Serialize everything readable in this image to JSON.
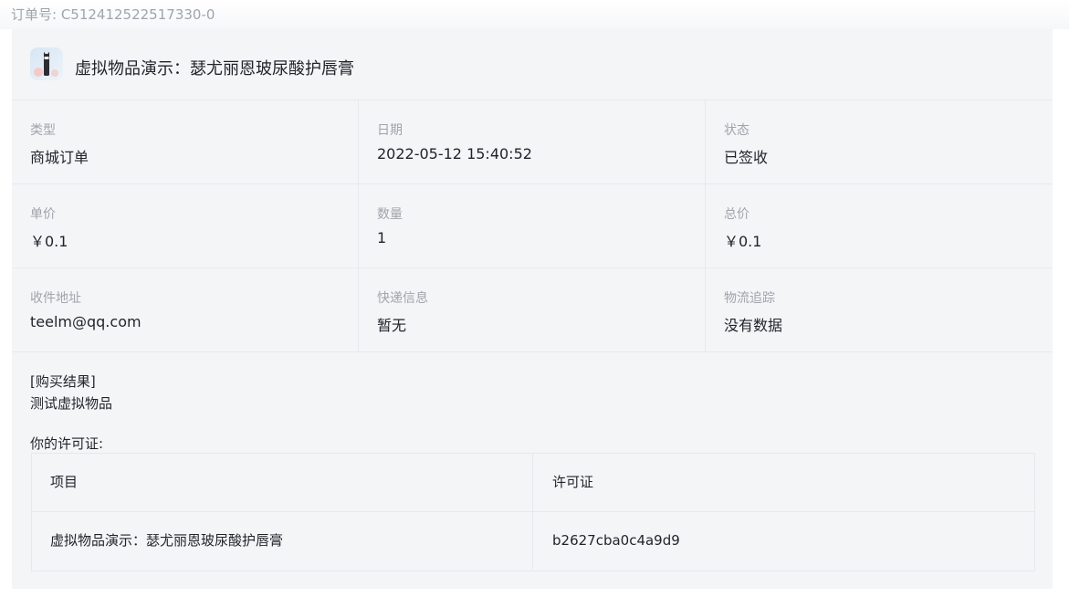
{
  "order": {
    "number_label": "订单号: C512412522517330-0"
  },
  "product": {
    "title": "虚拟物品演示：瑟尤丽恩玻尿酸护唇膏",
    "thumb_icon": "lip-balm-product-image"
  },
  "details": [
    [
      {
        "label": "类型",
        "value": "商城订单"
      },
      {
        "label": "日期",
        "value": "2022-05-12 15:40:52"
      },
      {
        "label": "状态",
        "value": "已签收"
      }
    ],
    [
      {
        "label": "单价",
        "value": "￥0.1"
      },
      {
        "label": "数量",
        "value": "1"
      },
      {
        "label": "总价",
        "value": "￥0.1"
      }
    ],
    [
      {
        "label": "收件地址",
        "value": "teelm@qq.com"
      },
      {
        "label": "快递信息",
        "value": "暂无"
      },
      {
        "label": "物流追踪",
        "value": "没有数据"
      }
    ]
  ],
  "result": {
    "heading": "[购买结果]",
    "text": "测试虚拟物品",
    "license_title": "你的许可证:"
  },
  "license_table": {
    "headers": [
      "项目",
      "许可证"
    ],
    "rows": [
      [
        "虚拟物品演示：瑟尤丽恩玻尿酸护唇膏",
        "b2627cba0c4a9d9"
      ]
    ]
  }
}
